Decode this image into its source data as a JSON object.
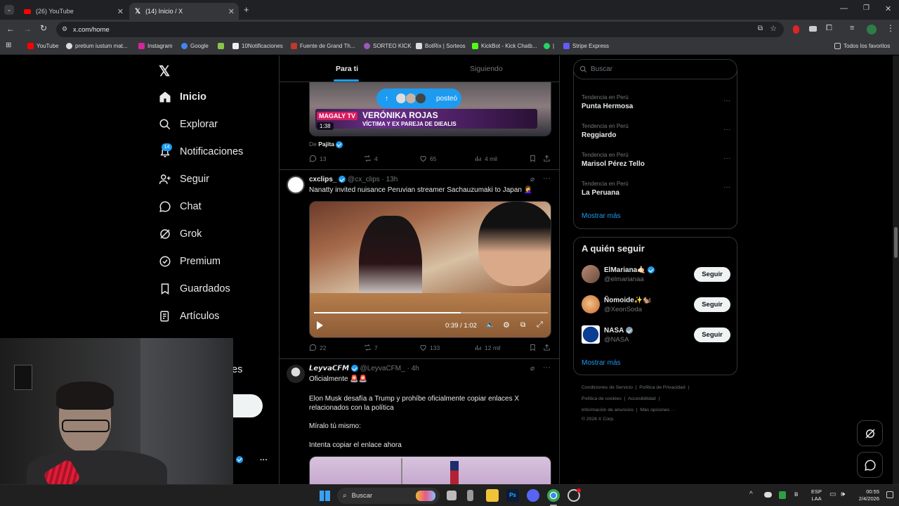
{
  "browser": {
    "tabs": [
      {
        "label": "(26) YouTube"
      },
      {
        "label": "(14) Inicio / X"
      }
    ],
    "url": "x.com/home",
    "bookmarks": [
      "YouTube",
      "pretium iustum mat...",
      "Instagram",
      "Google",
      "10Notificaciones",
      "Fuente de Grand Th...",
      "SORTEO KICK",
      "BotRix | Sorteos",
      "KickBot - Kick Chatb...",
      "|",
      "Stripe Express"
    ],
    "all_favorites": "Todos los favoritos"
  },
  "nav": {
    "home": "Inicio",
    "explore": "Explorar",
    "notifications": "Notificaciones",
    "notif_badge": "14",
    "follow": "Seguir",
    "chat": "Chat",
    "grok": "Grok",
    "premium": "Premium",
    "bookmarks": "Guardados",
    "articles": "Artículos",
    "partial_more": "es",
    "more_dots": "···"
  },
  "feed": {
    "tabs": {
      "for_you": "Para ti",
      "following": "Siguiendo"
    },
    "posted_pill": "posteó",
    "post1": {
      "overlay_name": "VERÓNIKA ROJAS",
      "overlay_sub": "VÍCTIMA Y EX PAREJA DE DIEALIS",
      "overlay_logo": "MAGALY TV",
      "duration": "1:38",
      "from_label": "De",
      "from_name": "Pajita",
      "replies": "13",
      "reposts": "4",
      "likes": "65",
      "views": "4 mil"
    },
    "post2": {
      "name": "cxclips_",
      "handle": "@cx_clips",
      "time": "· 13h",
      "text": "Nanatty invited nuisance Peruvian streamer Sachauzumaki to Japan 🤦‍♀️",
      "video_time": "0:39 / 1:02",
      "replies": "22",
      "reposts": "7",
      "likes": "133",
      "views": "12 mil"
    },
    "post3": {
      "name": "𝙇𝙚𝙮𝙫𝙖𝘾𝙁𝙈",
      "handle": "@LeyvaCFM_",
      "time": "· 4h",
      "line1": "Oficialmente 🚨🚨",
      "line2": "Elon Musk desafía a Trump y prohíbe oficialmente copiar enlaces X relacionados con la política",
      "line3": "Míralo tú mismo:",
      "line4": "Intenta copiar el enlace ahora"
    }
  },
  "sidebar": {
    "search_placeholder": "Buscar",
    "trends": [
      {
        "meta": "Tendencia en Perú",
        "name": "Punta Hermosa"
      },
      {
        "meta": "Tendencia en Perú",
        "name": "Reggiardo"
      },
      {
        "meta": "Tendencia en Perú",
        "name": "Marisol Pérez Tello"
      },
      {
        "meta": "Tendencia en Perú",
        "name": "La Peruana"
      }
    ],
    "show_more": "Mostrar más",
    "who_to_follow": "A quién seguir",
    "suggestions": [
      {
        "name": "ElMariana🤙🏻",
        "handle": "@elmarianaa",
        "button": "Seguir"
      },
      {
        "name": "Ñomoide✨🐿️",
        "handle": "@XeonSoda",
        "button": "Seguir"
      },
      {
        "name": "NASA",
        "handle": "@NASA",
        "button": "Seguir"
      }
    ],
    "show_more2": "Mostrar más",
    "footer": {
      "l1a": "Condiciones de Servicio",
      "l1b": "Política de Privacidad",
      "l2a": "Política de cookies",
      "l2b": "Accesibilidad",
      "l3a": "Información de anuncios",
      "l3b": "Más opciones ···",
      "copy": "© 2026 X Corp."
    }
  },
  "taskbar": {
    "search": "Buscar",
    "lang1": "ESP",
    "lang2": "LAA",
    "time": "00:55",
    "date": "2/4/2026"
  },
  "colors": {
    "accent": "#1d9bf0",
    "bg": "#000000",
    "border": "#2f3336"
  }
}
